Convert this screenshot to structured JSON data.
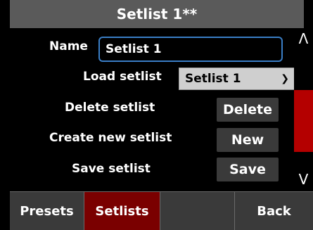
{
  "header": {
    "title": "Setlist 1**"
  },
  "form": {
    "name_label": "Name",
    "name_value": "Setlist 1",
    "load_label": "Load setlist",
    "load_selected": "Setlist 1",
    "delete_label": "Delete setlist",
    "delete_button": "Delete",
    "create_label": "Create new setlist",
    "new_button": "New",
    "save_label": "Save setlist",
    "save_button": "Save"
  },
  "scroll": {
    "up": "Λ",
    "down": "V"
  },
  "tabs": [
    {
      "label": "Presets",
      "active": false
    },
    {
      "label": "Setlists",
      "active": true
    },
    {
      "label": "",
      "active": false
    },
    {
      "label": "Back",
      "active": false
    }
  ],
  "colors": {
    "header_bg": "#5a5a5a",
    "accent_red": "#b40000",
    "active_tab": "#7a0000",
    "focus_blue": "#3a7ec6"
  }
}
